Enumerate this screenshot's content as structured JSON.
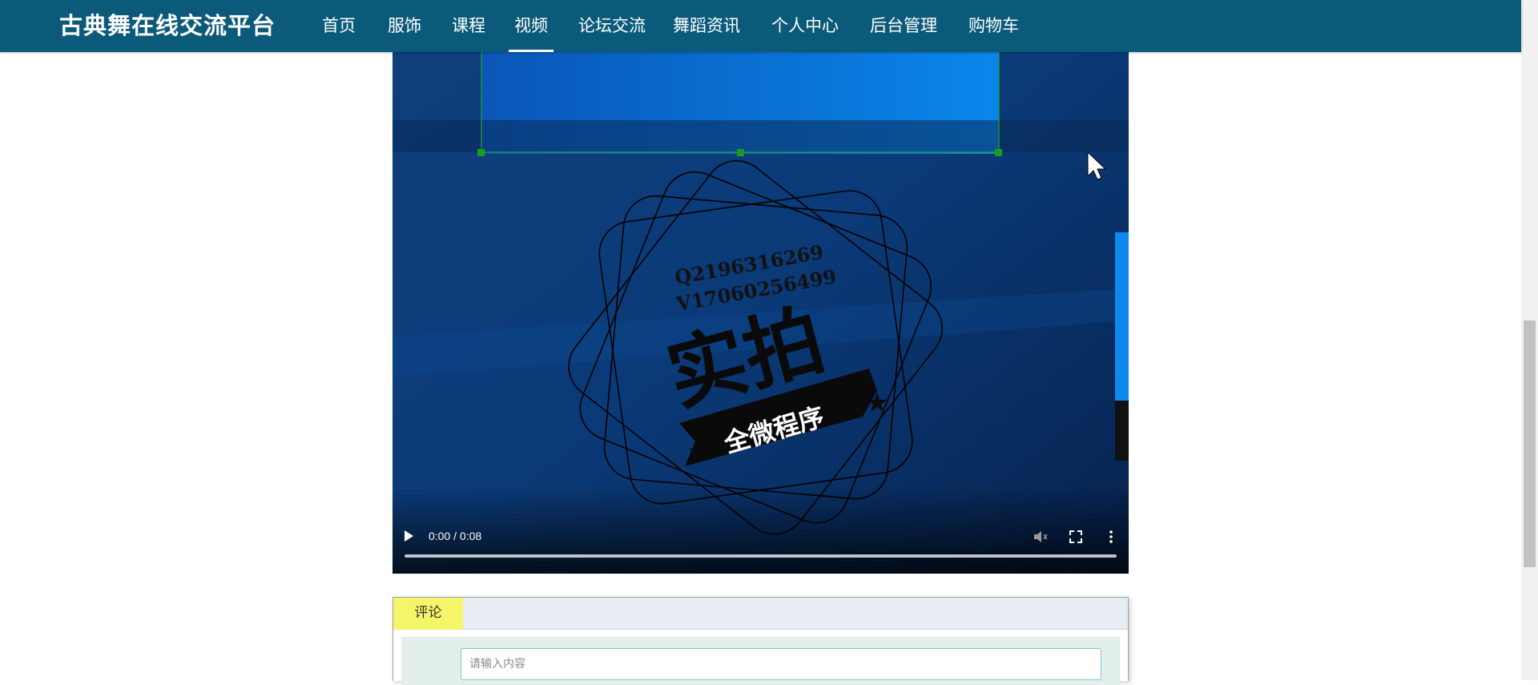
{
  "header": {
    "brand": "古典舞在线交流平台",
    "nav": [
      "首页",
      "服饰",
      "课程",
      "视频",
      "论坛交流",
      "舞蹈资讯",
      "个人中心",
      "后台管理",
      "购物车"
    ],
    "active": "视频"
  },
  "video": {
    "stamp_line1": "Q2196316269",
    "stamp_line2": "V17060256499",
    "stamp_main": "实拍",
    "stamp_banner": "全微程序",
    "time": "0:00 / 0:08",
    "progress": 0
  },
  "comments": {
    "tab_label": "评论",
    "input_placeholder": "请输入内容"
  },
  "colors": {
    "header_bg": "#0b5a7a",
    "tab_highlight": "#f5f56a",
    "comment_body_bg": "#e2efea"
  }
}
